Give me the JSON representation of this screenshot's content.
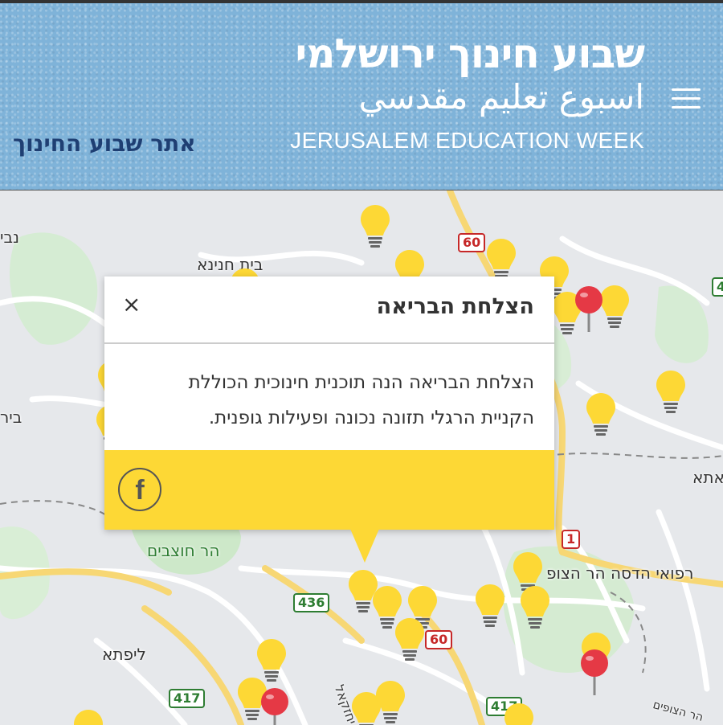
{
  "header": {
    "title_he": "שבוע חינוך ירושלמי",
    "title_ar": "اسبوع تعليم مقدسي",
    "title_en": "JERUSALEM EDUCATION WEEK",
    "site_link": "אתר שבוע החינוך",
    "menu_icon": "hamburger-menu-icon",
    "accent_color": "#7fb3d9",
    "link_color": "#1f3f73"
  },
  "map": {
    "labels": [
      "נבי",
      "בית חנינא",
      "ביר",
      "אתא",
      "הר חוצבים",
      "רפואי הדסה הר הצופ",
      "ליפתא",
      "יחזקאל",
      "הר הצופים"
    ],
    "routes": [
      "60",
      "1",
      "436",
      "60",
      "417",
      "417",
      "4"
    ],
    "marker_icon": "lightbulb-marker-icon",
    "pin_icon": "map-pin-icon",
    "bulb_color": "#fdd835",
    "pin_color": "#e53945"
  },
  "popup": {
    "title": "הצלחת הבריאה",
    "close": "×",
    "body_line1": "הצלחת הבריאה הנה תוכנית חינוכית הכוללת",
    "body_line2": "הקניית הרגלי תזונה נכונה ופעילות גופנית.",
    "facebook_icon": "f",
    "footer_color": "#fdd835"
  }
}
